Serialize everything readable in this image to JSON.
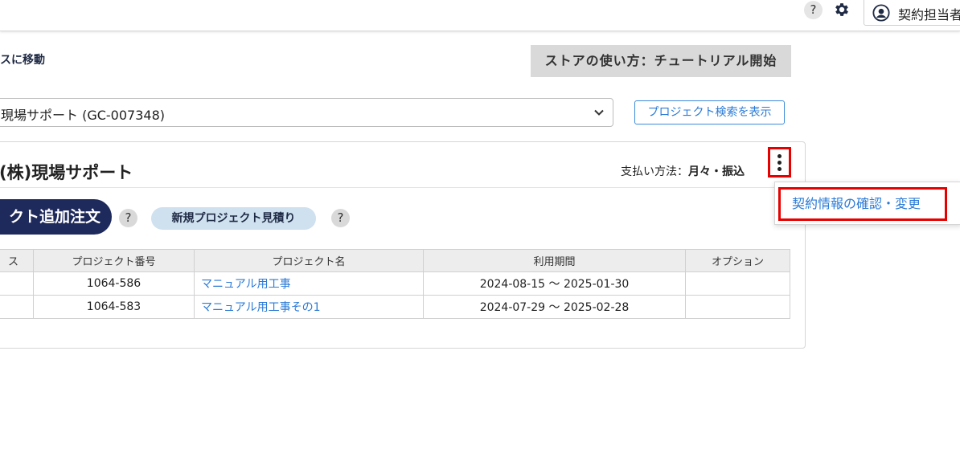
{
  "topbar": {
    "help_label": "?",
    "user_name": "契約担当者"
  },
  "header": {
    "nav_link": "スに移動",
    "tutorial_button": "ストアの使い方：チュートリアル開始"
  },
  "project_select": {
    "value": "現場サポート (GC-007348)",
    "search_toggle": "プロジェクト検索を表示"
  },
  "card": {
    "company": "(株)現場サポート",
    "payment_label": "支払い方法：",
    "payment_value": "月々・振込",
    "order_button": "クト追加注文",
    "help1": "?",
    "estimate_button": "新規プロジェクト見積り",
    "help2": "?"
  },
  "table": {
    "headers": [
      "ス",
      "プロジェクト番号",
      "プロジェクト名",
      "利用期間",
      "オプション"
    ],
    "rows": [
      {
        "status": "",
        "number": "1064-586",
        "name": "マニュアル用工事",
        "period": "2024-08-15 ～ 2025-01-30",
        "option": ""
      },
      {
        "status": "",
        "number": "1064-583",
        "name": "マニュアル用工事その1",
        "period": "2024-07-29 ～ 2025-02-28",
        "option": ""
      }
    ]
  },
  "menu": {
    "item": "契約情報の確認・変更"
  },
  "colors": {
    "primary_navy": "#1f2a5c",
    "link_blue": "#2a7ad6",
    "highlight_red": "#e60000",
    "estimate_bg": "#cfe0ef"
  }
}
